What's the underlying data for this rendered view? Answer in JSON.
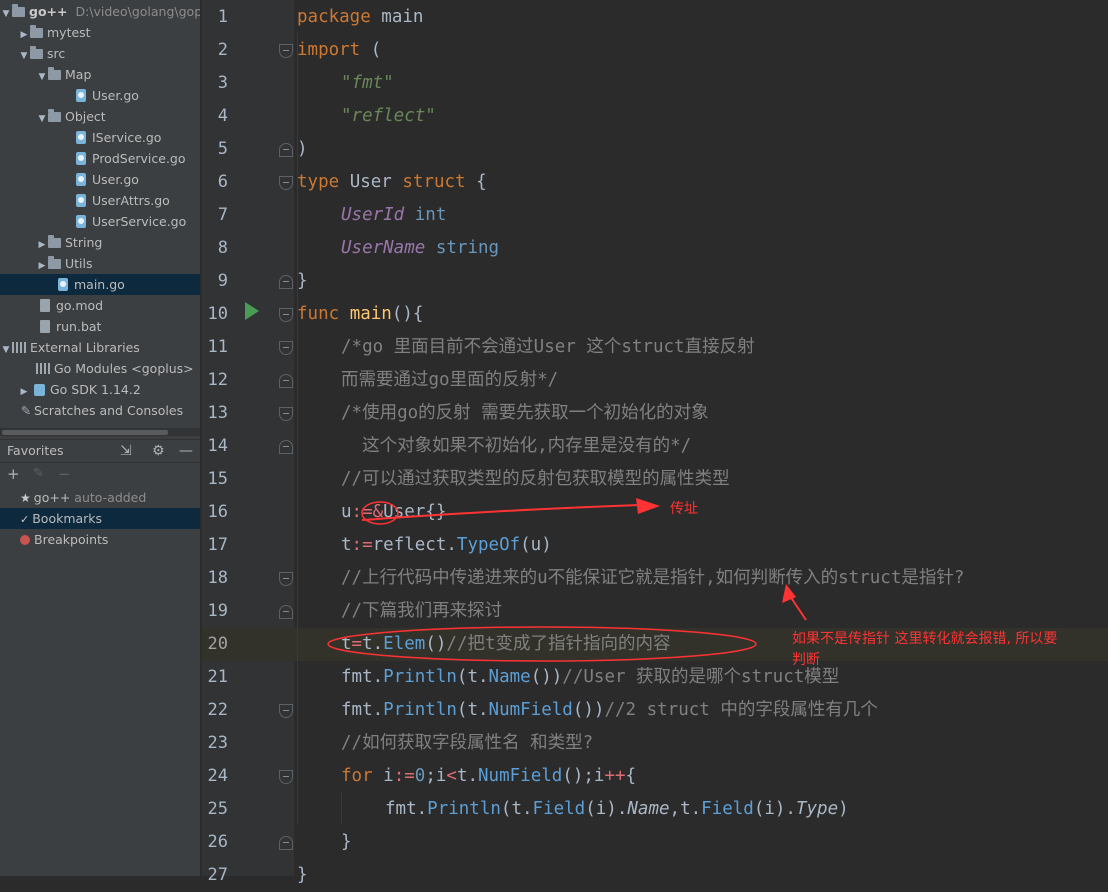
{
  "project_tree": {
    "root": {
      "name": "go++",
      "path": "D:\\video\\golang\\gop"
    },
    "items": [
      {
        "label": "mytest"
      },
      {
        "label": "src"
      },
      {
        "label": "Map"
      },
      {
        "label": "User.go"
      },
      {
        "label": "Object"
      },
      {
        "label": "IService.go"
      },
      {
        "label": "ProdService.go"
      },
      {
        "label": "User.go"
      },
      {
        "label": "UserAttrs.go"
      },
      {
        "label": "UserService.go"
      },
      {
        "label": "String"
      },
      {
        "label": "Utils"
      },
      {
        "label": "main.go"
      },
      {
        "label": "go.mod"
      },
      {
        "label": "run.bat"
      },
      {
        "label": "External Libraries"
      },
      {
        "label": "Go Modules",
        "suffix": "<goplus>"
      },
      {
        "label": "Go SDK 1.14.2"
      },
      {
        "label": "Scratches and Consoles"
      }
    ]
  },
  "favorites": {
    "title": "Favorites",
    "items": [
      {
        "label": "go++",
        "suffix": "auto-added"
      },
      {
        "label": "Bookmarks"
      },
      {
        "label": "Breakpoints"
      }
    ]
  },
  "editor": {
    "current_line": 20,
    "line_numbers": [
      "1",
      "2",
      "3",
      "4",
      "5",
      "6",
      "7",
      "8",
      "9",
      "10",
      "11",
      "12",
      "13",
      "14",
      "15",
      "16",
      "17",
      "18",
      "19",
      "20",
      "21",
      "22",
      "23",
      "24",
      "25",
      "26",
      "27"
    ]
  },
  "code": {
    "l1_kw": "package",
    "l1_name": " main",
    "l2_kw": "import",
    "l2_rest": " (",
    "l3_str": "\"fmt\"",
    "l4_str": "\"reflect\"",
    "l5": ")",
    "l6_kw1": "type",
    "l6_name": " User ",
    "l6_kw2": "struct",
    "l6_brace": " {",
    "l7_field": "UserId",
    "l7_type": " int",
    "l8_field": "UserName",
    "l8_type": " string",
    "l9": "}",
    "l10_kw": "func",
    "l10_fn": " main",
    "l10_rest": "(){",
    "l11": "/*go 里面目前不会通过User 这个struct直接反射",
    "l12": "而需要通过go里面的反射*/",
    "l13": "/*使用go的反射 需要先获取一个初始化的对象",
    "l14": "  这个对象如果不初始化,内存里是没有的*/",
    "l15": "//可以通过获取类型的反射包获取模型的属性类型",
    "l16_a": "u",
    "l16_op": ":=",
    "l16_b": "&",
    "l16_c": "User{}",
    "l17_a": "t",
    "l17_op": ":=",
    "l17_b": "reflect.",
    "l17_m": "TypeOf",
    "l17_c": "(u)",
    "l18": "//上行代码中传递进来的u不能保证它就是指针,如何判断传入的struct是指针?",
    "l19": "//下篇我们再来探讨",
    "l20_a": "t",
    "l20_op": "=",
    "l20_b": "t.",
    "l20_m": "Elem",
    "l20_c": "()",
    "l20_cm": "//把t变成了指针指向的内容",
    "l21_a": "fmt.",
    "l21_m": "Println",
    "l21_b": "(t.",
    "l21_m2": "Name",
    "l21_c": "())",
    "l21_cm": "//User 获取的是哪个struct模型",
    "l22_a": "fmt.",
    "l22_m": "Println",
    "l22_b": "(t.",
    "l22_m2": "NumField",
    "l22_c": "())",
    "l22_cm": "//2 struct 中的字段属性有几个",
    "l23": "//如何获取字段属性名 和类型?",
    "l24_kw": "for",
    "l24_a": " i",
    "l24_op": ":=",
    "l24_n": "0",
    "l24_b": ";i",
    "l24_lt": "<",
    "l24_c": "t.",
    "l24_m": "NumField",
    "l24_d": "();i",
    "l24_pp": "++",
    "l24_e": "{",
    "l25_a": "fmt.",
    "l25_m": "Println",
    "l25_b": "(t.",
    "l25_m2": "Field",
    "l25_c": "(i).",
    "l25_f": "Name",
    "l25_d": ",t.",
    "l25_m3": "Field",
    "l25_e": "(i).",
    "l25_f2": "Type",
    "l25_g": ")",
    "l26": "}",
    "l27": "}"
  },
  "annotations": {
    "note1": "传址",
    "note2": "如果不是传指针  这里转化就会报错, 所以要",
    "note2b": "判断"
  },
  "colors": {
    "keyword": "#cc7832",
    "string": "#6a8759",
    "function": "#ffc66d",
    "comment": "#808080",
    "method": "#5c9fd6",
    "field": "#9876aa",
    "annotation": "#ff3333",
    "run_icon": "#499c54"
  }
}
